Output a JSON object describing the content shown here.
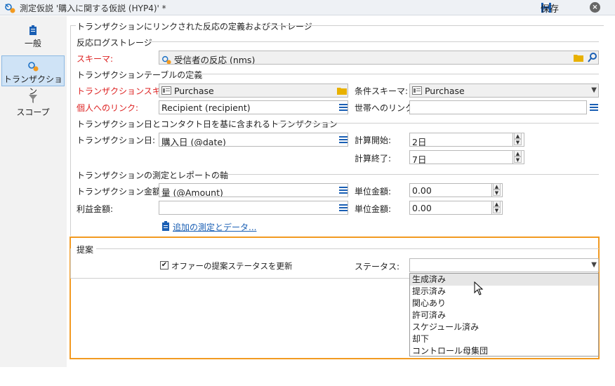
{
  "window": {
    "title": "測定仮説 '購入に関する仮説 (HYP4)' *",
    "save_label": "保存"
  },
  "sidebar": {
    "items": [
      {
        "label": "一般"
      },
      {
        "label": "トランザクション"
      },
      {
        "label": "スコープ"
      }
    ]
  },
  "main": {
    "section_title": "トランザクションにリンクされた反応の定義およびストレージ",
    "response_log": {
      "title": "反応ログストレージ",
      "schema_label": "スキーマ:",
      "schema_value": "受信者の反応 (nms)"
    },
    "tx_table": {
      "title": "トランザクションテーブルの定義",
      "tx_schema_label": "トランザクションスキーマ:",
      "tx_schema_value": "Purchase",
      "cond_schema_label": "条件スキーマ:",
      "cond_schema_value": "Purchase",
      "indiv_link_label": "個人へのリンク:",
      "indiv_link_value": "Recipient (recipient)",
      "household_link_label": "世帯へのリンク:",
      "household_link_value": ""
    },
    "tx_dates": {
      "title": "トランザクション日とコンタクト日を基に含まれるトランザクション",
      "tx_date_label": "トランザクション日:",
      "tx_date_value": "購入日 (@date)",
      "calc_start_label": "計算開始:",
      "calc_start_value": "2日",
      "calc_end_label": "計算終了:",
      "calc_end_value": "7日"
    },
    "measures": {
      "title": "トランザクションの測定とレポートの軸",
      "amount_label": "トランザクション金額:",
      "amount_value": "量 (@Amount)",
      "unit_amount_label": "単位金額:",
      "unit_amount_value": "0.00",
      "profit_label": "利益金額:",
      "profit_value": "",
      "unit_amount2_label": "単位金額:",
      "unit_amount2_value": "0.00",
      "add_link": "追加の測定とデータ..."
    },
    "proposal": {
      "title": "提案",
      "checkbox_label": "オファーの提案ステータスを更新",
      "checkbox_checked": "✔",
      "status_label": "ステータス:",
      "status_value": "",
      "options": [
        "生成済み",
        "提示済み",
        "関心あり",
        "許可済み",
        "スケジュール済み",
        "却下",
        "コントロール母集団"
      ]
    }
  },
  "colors": {
    "highlight": "#f29a21",
    "required_label": "#d22",
    "link": "#1a5fb4"
  }
}
